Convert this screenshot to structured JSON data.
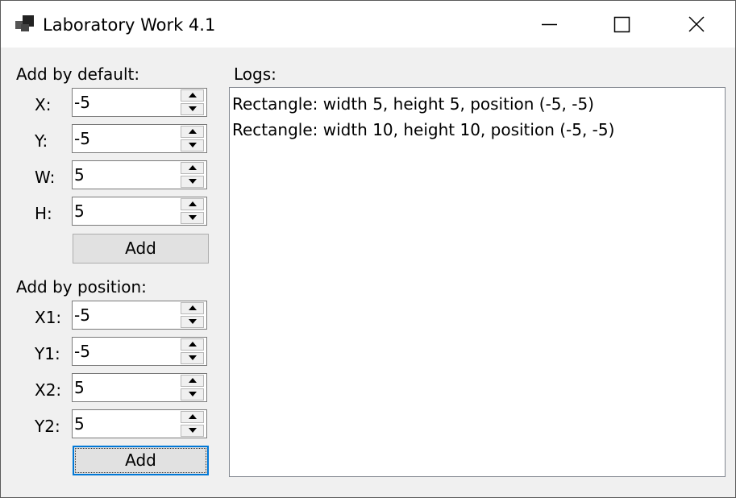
{
  "window": {
    "title": "Laboratory Work 4.1",
    "icon": "app-icon"
  },
  "caption_buttons": [
    "minimize-icon",
    "maximize-icon",
    "close-icon"
  ],
  "add_default": {
    "heading": "Add by default:",
    "fields": [
      {
        "label": "X:",
        "value": "-5"
      },
      {
        "label": "Y:",
        "value": "-5"
      },
      {
        "label": "W:",
        "value": "5"
      },
      {
        "label": "H:",
        "value": "5"
      }
    ],
    "button_label": "Add"
  },
  "add_position": {
    "heading": "Add by position:",
    "fields": [
      {
        "label": "X1:",
        "value": "-5"
      },
      {
        "label": "Y1:",
        "value": "-5"
      },
      {
        "label": "X2:",
        "value": "5"
      },
      {
        "label": "Y2:",
        "value": "5"
      }
    ],
    "button_label": "Add"
  },
  "logs": {
    "heading": "Logs:",
    "lines": [
      "Rectangle: width 5, height 5, position (-5, -5)",
      "Rectangle: width 10, height 10, position (-5, -5)"
    ]
  },
  "colors": {
    "focus_border": "#0078d7",
    "window_bg": "#f0f0f0",
    "titlebar_bg": "#ffffff"
  }
}
